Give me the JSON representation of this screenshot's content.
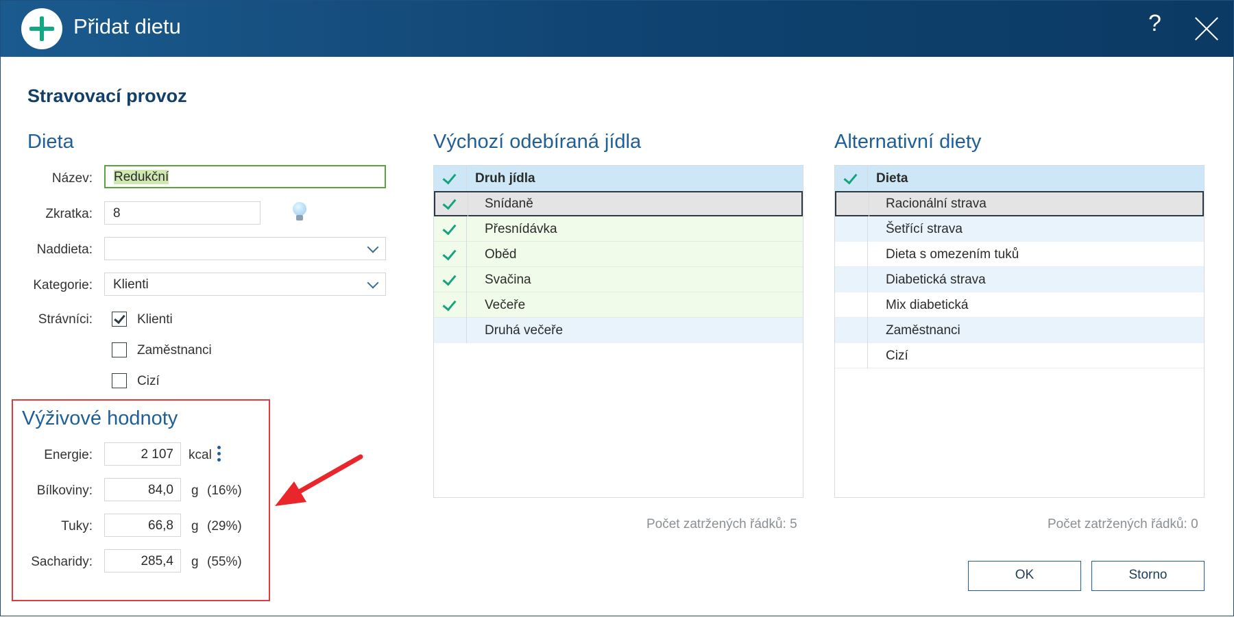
{
  "window": {
    "title": "Přidat dietu",
    "help": "?"
  },
  "heading": "Stravovací provoz",
  "dieta": {
    "title": "Dieta",
    "nazev_label": "Název:",
    "nazev_value": "Redukční",
    "zkratka_label": "Zkratka:",
    "zkratka_value": "8",
    "naddieta_label": "Naddieta:",
    "naddieta_value": "",
    "kategorie_label": "Kategorie:",
    "kategorie_value": "Klienti",
    "stravnici_label": "Strávníci:",
    "stravnici": [
      {
        "label": "Klienti",
        "checked": true
      },
      {
        "label": "Zaměstnanci",
        "checked": false
      },
      {
        "label": "Cizí",
        "checked": false
      }
    ]
  },
  "vyziva": {
    "title": "Výživové hodnoty",
    "rows": [
      {
        "label": "Energie:",
        "value": "2 107",
        "unit": "kcal",
        "pct": ""
      },
      {
        "label": "Bílkoviny:",
        "value": "84,0",
        "unit": "g",
        "pct": "(16%)"
      },
      {
        "label": "Tuky:",
        "value": "66,8",
        "unit": "g",
        "pct": "(29%)"
      },
      {
        "label": "Sacharidy:",
        "value": "285,4",
        "unit": "g",
        "pct": "(55%)"
      }
    ]
  },
  "jidla": {
    "title": "Výchozí odebíraná jídla",
    "column": "Druh jídla",
    "rows": [
      {
        "label": "Snídaně",
        "checked": true
      },
      {
        "label": "Přesnídávka",
        "checked": true
      },
      {
        "label": "Oběd",
        "checked": true
      },
      {
        "label": "Svačina",
        "checked": true
      },
      {
        "label": "Večeře",
        "checked": true
      },
      {
        "label": "Druhá večeře",
        "checked": false
      }
    ],
    "count": "Počet zatržených řádků: 5"
  },
  "alternativni": {
    "title": "Alternativní diety",
    "column": "Dieta",
    "rows": [
      {
        "label": "Racionální strava",
        "checked": false
      },
      {
        "label": "Šetřící strava",
        "checked": false
      },
      {
        "label": "Dieta s omezením tuků",
        "checked": false
      },
      {
        "label": "Diabetická strava",
        "checked": false
      },
      {
        "label": "Mix diabetická",
        "checked": false
      },
      {
        "label": "Zaměstnanci",
        "checked": false
      },
      {
        "label": "Cizí",
        "checked": false
      }
    ],
    "count": "Počet zatržených řádků: 0"
  },
  "buttons": {
    "ok": "OK",
    "cancel": "Storno"
  },
  "colors": {
    "titlebar": "#0f426f",
    "accent": "#1f5f99",
    "check": "#14a37f",
    "highlight": "#e0393e"
  }
}
